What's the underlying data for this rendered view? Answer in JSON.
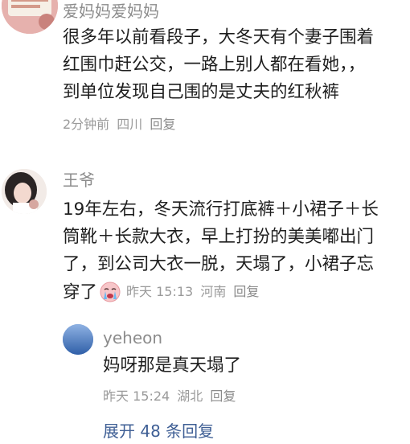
{
  "comments": [
    {
      "username": "爱妈妈爱妈妈",
      "lines": [
        "很多年以前看段子，大冬天有个妻子围着",
        "红围巾赶公交，一路上别人都在看她，，",
        "到单位发现自己围的是丈夫的红秋裤"
      ],
      "time": "2分钟前",
      "location": "四川",
      "reply_label": "回复"
    },
    {
      "username": "王爷",
      "lines": [
        "19年左右，冬天流行打底裤＋小裙子＋长",
        "筒靴＋长款大衣，早上打扮的美美嘟出门",
        "了，到公司大衣一脱，天塌了，小裙子忘",
        "穿了"
      ],
      "emoji": "crying-face-emoji",
      "time": "昨天 15:13",
      "location": "河南",
      "reply_label": "回复",
      "replies": [
        {
          "username": "yeheon",
          "text": "妈呀那是真天塌了",
          "time": "昨天 15:24",
          "location": "湖北",
          "reply_label": "回复"
        }
      ],
      "expand_label": "展开 48 条回复"
    }
  ],
  "colors": {
    "username": "#8c8c8c",
    "body_text": "#1f1f1f",
    "meta": "#9a9a9a",
    "expand_link": "#3f5f95",
    "reply_avatar": "#5a86c9"
  }
}
